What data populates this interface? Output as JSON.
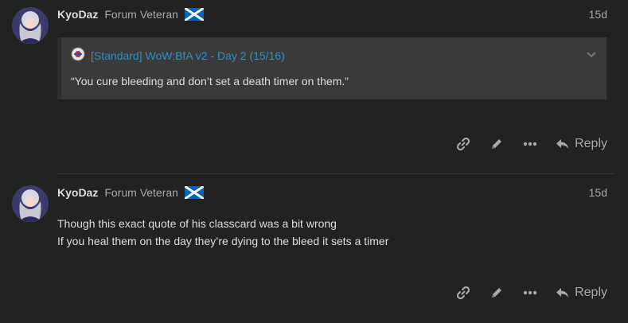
{
  "posts": [
    {
      "username": "KyoDaz",
      "user_title": "Forum Veteran",
      "date": "15d",
      "quote": {
        "link_text": "[Standard] WoW:BfA v2 - Day 2 (15/16)",
        "text": "“You cure bleeding and don’t set a death timer on them.”"
      },
      "reply_label": "Reply"
    },
    {
      "username": "KyoDaz",
      "user_title": "Forum Veteran",
      "date": "15d",
      "lines": [
        "Though this exact quote of his classcard was a bit wrong",
        "If you heal them on the day they’re dying to the bleed it sets a timer"
      ],
      "reply_label": "Reply"
    }
  ],
  "colors": {
    "background": "#222222",
    "link": "#2e8fc9",
    "quote_background": "#3a3a3a",
    "muted": "#a9a9a9"
  },
  "icons": [
    "link-icon",
    "pencil-icon",
    "more-icon",
    "reply-icon",
    "chevron-down-icon",
    "scotland-flag-icon"
  ]
}
